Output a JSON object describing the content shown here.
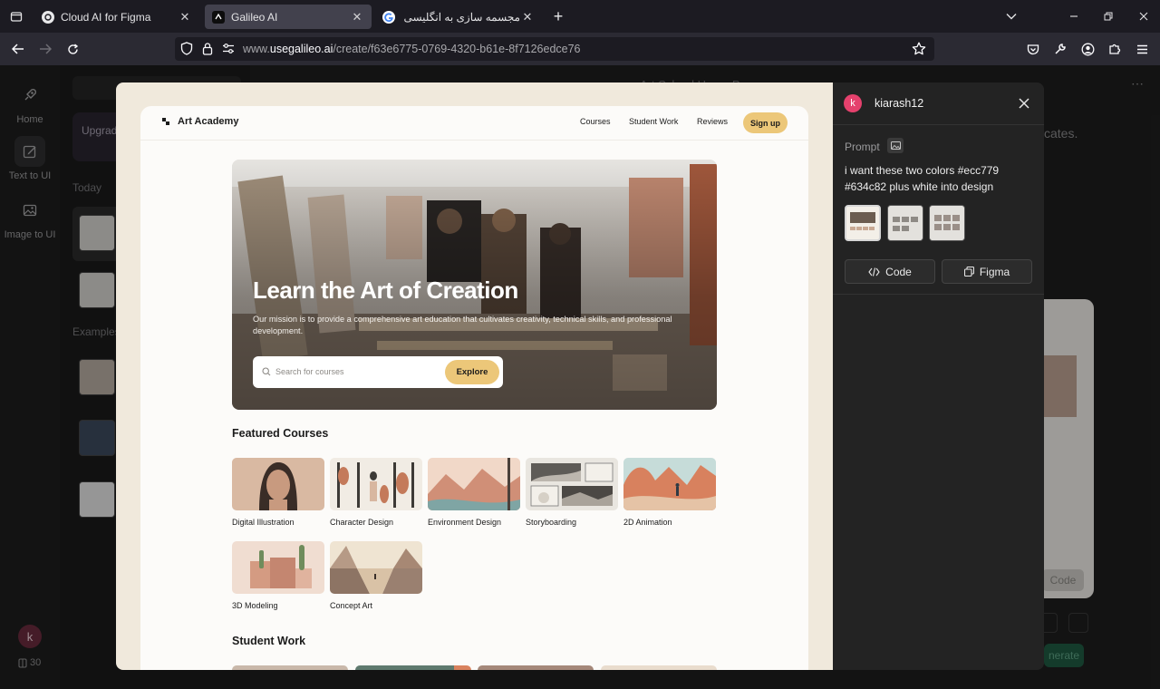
{
  "browser": {
    "tabs": [
      {
        "title": "Cloud AI for Figma",
        "favicon": "openai-icon"
      },
      {
        "title": "Galileo AI",
        "favicon": "galileo-icon",
        "active": true
      },
      {
        "title": "مجسمه سازی به انگلیسی - earch",
        "favicon": "google-icon"
      }
    ],
    "url_prefix": "www.",
    "url_domain": "usegalileo.ai",
    "url_path": "/create/f63e6775-0769-4320-b61e-8f7126edce76"
  },
  "leftnav": {
    "items": [
      {
        "label": "Home",
        "icon": "rocket-icon"
      },
      {
        "label": "Text to UI",
        "icon": "edit-icon"
      },
      {
        "label": "Image to UI",
        "icon": "image-icon"
      }
    ],
    "avatar_letter": "k",
    "credits": "30"
  },
  "history": {
    "upgrade_text": "Upgrade for full access",
    "today_label": "Today",
    "examples_label": "Examples"
  },
  "background": {
    "title": "Art School Home Page",
    "cates_text": "cates.",
    "code_label": "Code",
    "generate_label": "nerate"
  },
  "preview": {
    "brand": "Art Academy",
    "nav": [
      "Courses",
      "Student Work",
      "Reviews"
    ],
    "signup": "Sign up",
    "hero_title": "Learn the Art of Creation",
    "hero_text": "Our mission is to provide a comprehensive art education that cultivates creativity, technical skills, and professional development.",
    "search_placeholder": "Search for courses",
    "explore": "Explore",
    "featured_title": "Featured Courses",
    "courses": [
      "Digital Illustration",
      "Character Design",
      "Environment Design",
      "Storyboarding",
      "2D Animation",
      "3D Modeling",
      "Concept Art"
    ],
    "student_title": "Student Work"
  },
  "panel": {
    "avatar_letter": "k",
    "username": "kiarash12",
    "prompt_label": "Prompt",
    "prompt_text": "i want these two colors  #ecc779  #634c82  plus white into design",
    "code_label": "Code",
    "figma_label": "Figma"
  },
  "colors": {
    "accent_yellow": "#ecc779",
    "accent_purple": "#634c82",
    "avatar_pink": "#e5416d"
  }
}
